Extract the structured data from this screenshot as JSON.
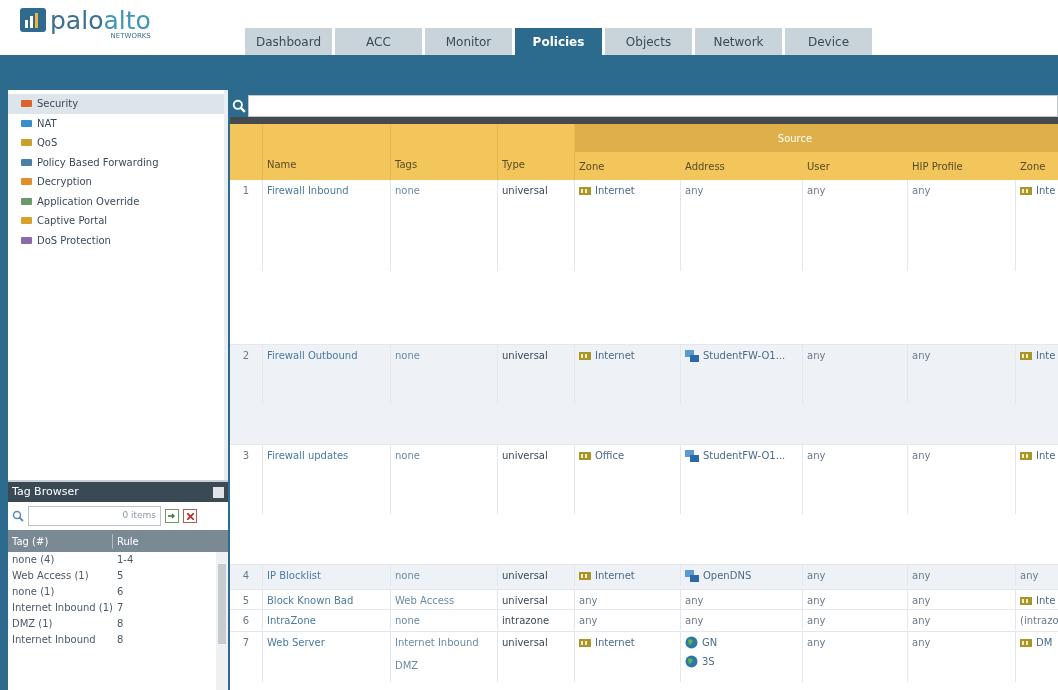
{
  "logo": {
    "part_a": "palo",
    "part_b": "alto",
    "sub": "NETWORKS"
  },
  "tabs": [
    {
      "label": "Dashboard",
      "selected": false
    },
    {
      "label": "ACC",
      "selected": false
    },
    {
      "label": "Monitor",
      "selected": false
    },
    {
      "label": "Policies",
      "selected": true
    },
    {
      "label": "Objects",
      "selected": false
    },
    {
      "label": "Network",
      "selected": false
    },
    {
      "label": "Device",
      "selected": false
    }
  ],
  "sidebar": {
    "items": [
      {
        "label": "Security",
        "selected": true
      },
      {
        "label": "NAT",
        "selected": false
      },
      {
        "label": "QoS",
        "selected": false
      },
      {
        "label": "Policy Based Forwarding",
        "selected": false
      },
      {
        "label": "Decryption",
        "selected": false
      },
      {
        "label": "Application Override",
        "selected": false
      },
      {
        "label": "Captive Portal",
        "selected": false
      },
      {
        "label": "DoS Protection",
        "selected": false
      }
    ]
  },
  "tag_browser": {
    "title": "Tag Browser",
    "count": "0 items",
    "columns": [
      "Tag (#)",
      "Rule"
    ],
    "rows": [
      {
        "tag": "none (4)",
        "rule": "1-4"
      },
      {
        "tag": "Web Access (1)",
        "rule": "5"
      },
      {
        "tag": "none (1)",
        "rule": "6"
      },
      {
        "tag": "Internet Inbound (1)",
        "rule": "7"
      },
      {
        "tag": "DMZ (1)",
        "rule": "8"
      },
      {
        "tag": "Internet Inbound",
        "rule": "8"
      }
    ]
  },
  "table": {
    "group": "Source",
    "columns": [
      "Name",
      "Tags",
      "Type",
      "Zone",
      "Address",
      "User",
      "HIP Profile",
      "Zone"
    ],
    "rows": [
      {
        "num": "1",
        "name": "Firewall Inbound",
        "tags": [
          "none"
        ],
        "type": "universal",
        "src_zone": {
          "text": "Internet",
          "kind": "zone"
        },
        "src_address": [
          {
            "text": "any",
            "kind": "plain"
          }
        ],
        "user": "any",
        "hip": "any",
        "dst_zone": {
          "text": "Inte",
          "kind": "zone"
        },
        "selected": false
      },
      {
        "num": "2",
        "name": "Firewall Outbound",
        "tags": [
          "none"
        ],
        "type": "universal",
        "src_zone": {
          "text": "Internet",
          "kind": "zone"
        },
        "src_address": [
          {
            "text": "StudentFW-O1...",
            "kind": "address"
          }
        ],
        "user": "any",
        "hip": "any",
        "dst_zone": {
          "text": "Inte",
          "kind": "zone"
        },
        "selected": true
      },
      {
        "num": "3",
        "name": "Firewall updates",
        "tags": [
          "none"
        ],
        "type": "universal",
        "src_zone": {
          "text": "Office",
          "kind": "zone"
        },
        "src_address": [
          {
            "text": "StudentFW-O1...",
            "kind": "address"
          }
        ],
        "user": "any",
        "hip": "any",
        "dst_zone": {
          "text": "Inte",
          "kind": "zone"
        },
        "selected": false
      },
      {
        "num": "4",
        "name": "IP Blocklist",
        "tags": [
          "none"
        ],
        "type": "universal",
        "src_zone": {
          "text": "Internet",
          "kind": "zone"
        },
        "src_address": [
          {
            "text": "OpenDNS",
            "kind": "address"
          }
        ],
        "user": "any",
        "hip": "any",
        "dst_zone": {
          "text": "any",
          "kind": "plain"
        },
        "selected": true
      },
      {
        "num": "5",
        "name": "Block Known Bad",
        "tags": [
          "Web Access"
        ],
        "type": "universal",
        "src_zone": {
          "text": "any",
          "kind": "plain"
        },
        "src_address": [
          {
            "text": "any",
            "kind": "plain"
          }
        ],
        "user": "any",
        "hip": "any",
        "dst_zone": {
          "text": "Inte",
          "kind": "zone"
        },
        "selected": false
      },
      {
        "num": "6",
        "name": "IntraZone",
        "tags": [
          "none"
        ],
        "type": "intrazone",
        "src_zone": {
          "text": "any",
          "kind": "plain"
        },
        "src_address": [
          {
            "text": "any",
            "kind": "plain"
          }
        ],
        "user": "any",
        "hip": "any",
        "dst_zone": {
          "text": "(intrazo",
          "kind": "plain"
        },
        "selected": false
      },
      {
        "num": "7",
        "name": "Web Server",
        "tags": [
          "Internet Inbound",
          "DMZ"
        ],
        "type": "universal",
        "src_zone": {
          "text": "Internet",
          "kind": "zone"
        },
        "src_address": [
          {
            "text": "GN",
            "kind": "globe"
          },
          {
            "text": "3S",
            "kind": "globe"
          }
        ],
        "user": "any",
        "hip": "any",
        "dst_zone": {
          "text": "DM",
          "kind": "zone"
        },
        "selected": false
      }
    ]
  }
}
